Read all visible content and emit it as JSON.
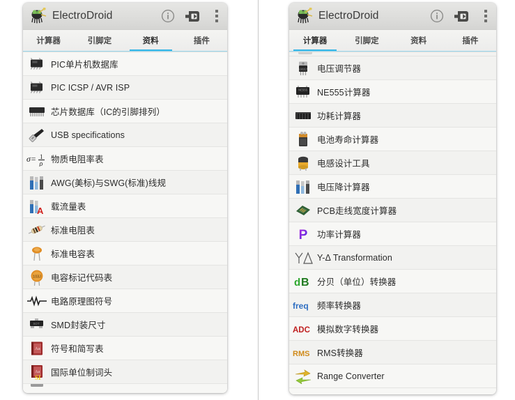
{
  "app": {
    "title": "ElectroDroid",
    "logo_icon": "electrodroid-bug-icon",
    "actions": [
      {
        "name": "info-icon",
        "label": "i"
      },
      {
        "name": "cast-connect-icon",
        "label": ""
      },
      {
        "name": "overflow-menu-icon",
        "label": ""
      }
    ]
  },
  "left_panel": {
    "name": "resources-screen",
    "tabs": [
      {
        "label": "计算器",
        "active": false
      },
      {
        "label": "引脚定",
        "active": false
      },
      {
        "label": "资料",
        "active": true
      },
      {
        "label": "插件",
        "active": false
      }
    ],
    "items": [
      {
        "icon": "soic-chip-icon",
        "label": "PIC单片机数据库"
      },
      {
        "icon": "soic-chip-icon",
        "label": "PIC ICSP / AVR ISP"
      },
      {
        "icon": "dip-chip-icon",
        "label": "芯片数据库（IC的引脚排列）"
      },
      {
        "icon": "usb-connector-icon",
        "label": "USB specifications"
      },
      {
        "icon": "resistivity-formula-icon",
        "label": "物质电阻率表"
      },
      {
        "icon": "wire-gauge-icon",
        "label": "AWG(美标)与SWG(标准)线规"
      },
      {
        "icon": "wire-ampacity-icon",
        "label": "载流量表"
      },
      {
        "icon": "resistor-icon",
        "label": "标准电阻表"
      },
      {
        "icon": "ceramic-capacitor-icon",
        "label": "标准电容表"
      },
      {
        "icon": "capacitor-code-icon",
        "label": "电容标记代码表"
      },
      {
        "icon": "schematic-symbol-icon",
        "label": "电路原理图符号"
      },
      {
        "icon": "smd-package-icon",
        "label": "SMD封装尺寸"
      },
      {
        "icon": "abbreviations-book-icon",
        "label": "符号和简写表"
      },
      {
        "icon": "si-prefix-book-icon",
        "label": "国际单位制词头"
      }
    ]
  },
  "right_panel": {
    "name": "calculators-screen",
    "tabs": [
      {
        "label": "计算器",
        "active": true
      },
      {
        "label": "引脚定",
        "active": false
      },
      {
        "label": "资料",
        "active": false
      },
      {
        "label": "插件",
        "active": false
      }
    ],
    "items": [
      {
        "icon": "voltage-regulator-icon",
        "label": "电压调节器"
      },
      {
        "icon": "ne555-chip-icon",
        "label": "NE555计算器"
      },
      {
        "icon": "heatsink-icon",
        "label": "功耗计算器"
      },
      {
        "icon": "battery-icon",
        "label": "电池寿命计算器"
      },
      {
        "icon": "inductor-icon",
        "label": "电感设计工具"
      },
      {
        "icon": "wire-gauge-icon",
        "label": "电压降计算器"
      },
      {
        "icon": "pcb-board-icon",
        "label": "PCB走线宽度计算器"
      },
      {
        "icon": "power-p-icon",
        "label": "功率计算器"
      },
      {
        "icon": "wye-delta-icon",
        "label": "Y-Δ Transformation"
      },
      {
        "icon": "decibel-icon",
        "label": "分贝（单位）转换器"
      },
      {
        "icon": "frequency-icon",
        "label": "频率转换器"
      },
      {
        "icon": "adc-icon",
        "label": "模拟数字转换器"
      },
      {
        "icon": "rms-icon",
        "label": "RMS转换器"
      },
      {
        "icon": "range-converter-icon",
        "label": "Range Converter"
      }
    ]
  },
  "colors": {
    "accent": "#33b5e5",
    "actionbar": "#dddddb",
    "list_bg": "#f7f7f5",
    "text": "#2c2c2c"
  }
}
